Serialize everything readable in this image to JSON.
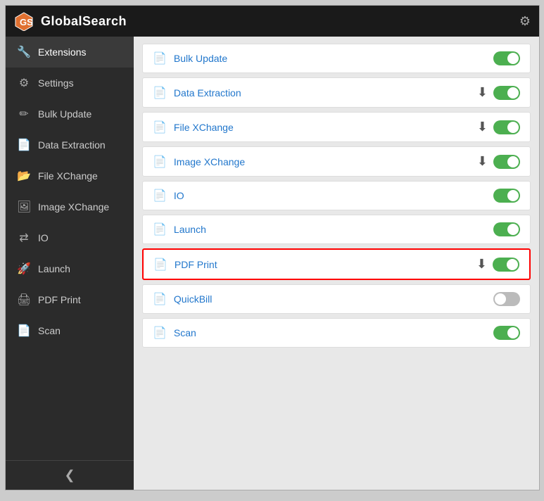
{
  "header": {
    "title": "GlobalSearch",
    "gear_label": "⚙"
  },
  "sidebar": {
    "items": [
      {
        "id": "extensions",
        "label": "Extensions",
        "icon": "🔧",
        "active": true
      },
      {
        "id": "settings",
        "label": "Settings",
        "icon": "⚙"
      },
      {
        "id": "bulk-update",
        "label": "Bulk Update",
        "icon": "✏"
      },
      {
        "id": "data-extraction",
        "label": "Data Extraction",
        "icon": "📄"
      },
      {
        "id": "file-xchange",
        "label": "File XChange",
        "icon": "📂"
      },
      {
        "id": "image-xchange",
        "label": "Image XChange",
        "icon": "🖼"
      },
      {
        "id": "io",
        "label": "IO",
        "icon": "⇄"
      },
      {
        "id": "launch",
        "label": "Launch",
        "icon": "🚀"
      },
      {
        "id": "pdf-print",
        "label": "PDF Print",
        "icon": "🖨"
      },
      {
        "id": "scan",
        "label": "Scan",
        "icon": "📄"
      }
    ],
    "collapse_icon": "❮"
  },
  "extensions": [
    {
      "id": "bulk-update",
      "label": "Bulk Update",
      "toggle": "on",
      "has_download": false
    },
    {
      "id": "data-extraction",
      "label": "Data Extraction",
      "toggle": "on",
      "has_download": true
    },
    {
      "id": "file-xchange",
      "label": "File XChange",
      "toggle": "on",
      "has_download": true
    },
    {
      "id": "image-xchange",
      "label": "Image XChange",
      "toggle": "on",
      "has_download": true
    },
    {
      "id": "io",
      "label": "IO",
      "toggle": "on",
      "has_download": false
    },
    {
      "id": "launch",
      "label": "Launch",
      "toggle": "on",
      "has_download": false
    },
    {
      "id": "pdf-print",
      "label": "PDF Print",
      "toggle": "on",
      "has_download": true,
      "highlighted": true
    },
    {
      "id": "quickbill",
      "label": "QuickBill",
      "toggle": "off",
      "has_download": false
    },
    {
      "id": "scan",
      "label": "Scan",
      "toggle": "on",
      "has_download": false
    }
  ]
}
